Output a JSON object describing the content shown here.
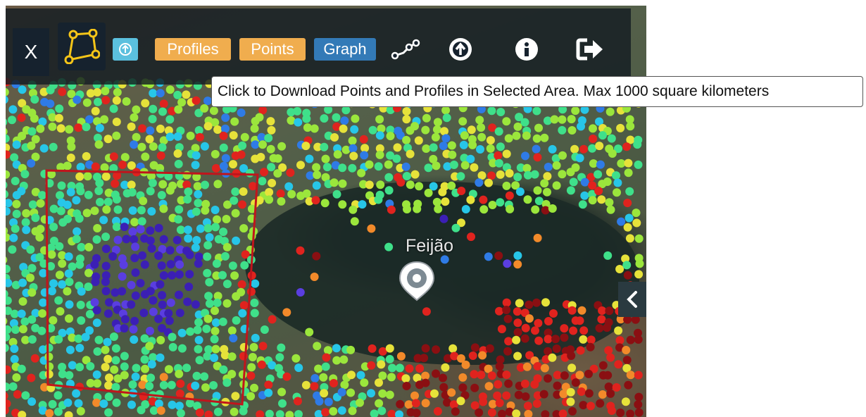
{
  "toolbar": {
    "close_label": "X",
    "profiles_label": "Profiles",
    "points_label": "Points",
    "graph_label": "Graph",
    "icons": [
      "polygon-draw-icon",
      "upload-circle-icon",
      "line-chart-icon",
      "upload-arrow-icon",
      "info-icon",
      "sign-out-icon"
    ]
  },
  "tooltip": {
    "text": "Click to Download Points and Profiles in Selected Area. Max 1000 square kilometers"
  },
  "map": {
    "place_label": "Feijão",
    "marker_icon": "location-pin-icon",
    "collapse_icon": "chevron-left-icon",
    "selection_color": "#c0151c",
    "point_color_scale": [
      "#3b1fb5",
      "#5a3ee0",
      "#2f7be6",
      "#27c6e8",
      "#3fe08a",
      "#9be63c",
      "#e6e23a",
      "#f28a2a",
      "#e0231e",
      "#8a0f12"
    ]
  },
  "colors": {
    "accent_orange": "#f0ad4e",
    "accent_blue": "#337ab7",
    "accent_cyan": "#5bc0de",
    "toolbar_bg": "#141c22"
  }
}
